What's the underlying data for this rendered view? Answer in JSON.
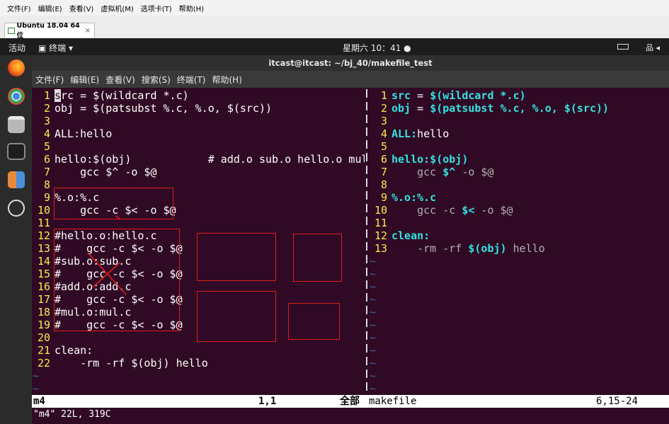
{
  "host_menu": [
    "文件(F)",
    "编辑(E)",
    "查看(V)",
    "虚拟机(M)",
    "选项卡(T)",
    "帮助(H)"
  ],
  "vm_tab": {
    "label": "Ubuntu 18.04 64 位",
    "close": "×"
  },
  "topbar": {
    "activities": "活动",
    "app": "▣ 终端 ▾",
    "clock": "星期六 10：41 ●",
    "net": "品 ◂"
  },
  "window_title": "itcast@itcast: ~/bj_40/makefile_test",
  "term_menu": [
    "文件(F)",
    "编辑(E)",
    "查看(V)",
    "搜索(S)",
    "终端(T)",
    "帮助(H)"
  ],
  "left_lines": [
    {
      "n": "1",
      "t": "src = $(wildcard *.c)"
    },
    {
      "n": "2",
      "t": "obj = $(patsubst %.c, %.o, $(src))"
    },
    {
      "n": "3",
      "t": ""
    },
    {
      "n": "4",
      "t": "ALL:hello"
    },
    {
      "n": "5",
      "t": ""
    },
    {
      "n": "6",
      "t": "hello:$(obj)            # add.o sub.o hello.o mul.o"
    },
    {
      "n": "7",
      "t": "    gcc $^ -o $@"
    },
    {
      "n": "8",
      "t": ""
    },
    {
      "n": "9",
      "t": "%.o:%.c"
    },
    {
      "n": "10",
      "t": "    gcc -c $< -o $@"
    },
    {
      "n": "11",
      "t": ""
    },
    {
      "n": "12",
      "t": "#hello.o:hello.c"
    },
    {
      "n": "13",
      "t": "#    gcc -c $< -o $@"
    },
    {
      "n": "14",
      "t": "#sub.o:sub.c"
    },
    {
      "n": "15",
      "t": "#    gcc -c $< -o $@"
    },
    {
      "n": "16",
      "t": "#add.o:add.c"
    },
    {
      "n": "17",
      "t": "#    gcc -c $< -o $@"
    },
    {
      "n": "18",
      "t": "#mul.o:mul.c"
    },
    {
      "n": "19",
      "t": "#    gcc -c $< -o $@"
    },
    {
      "n": "20",
      "t": ""
    },
    {
      "n": "21",
      "t": "clean:"
    },
    {
      "n": "22",
      "t": "    -rm -rf $(obj) hello"
    }
  ],
  "right_lines": [
    {
      "n": "1",
      "k": "src",
      "r": " = ",
      "v": "$(wildcard *.c)",
      "d": ""
    },
    {
      "n": "2",
      "k": "obj",
      "r": " = ",
      "v": "$(patsubst %.c, %.o, $(src))",
      "d": ""
    },
    {
      "n": "3",
      "k": "",
      "r": "",
      "v": "",
      "d": ""
    },
    {
      "n": "4",
      "k": "ALL:",
      "r": "hello",
      "v": "",
      "d": ""
    },
    {
      "n": "5",
      "k": "",
      "r": "",
      "v": "",
      "d": ""
    },
    {
      "n": "6",
      "k": "hello:$(obj)",
      "r": "",
      "v": "",
      "d": ""
    },
    {
      "n": "7",
      "k": "",
      "r": "    gcc ",
      "v": "$^",
      "d": " -o $@"
    },
    {
      "n": "8",
      "k": "",
      "r": "",
      "v": "",
      "d": ""
    },
    {
      "n": "9",
      "k": "%.o:%.c",
      "r": "",
      "v": "",
      "d": ""
    },
    {
      "n": "10",
      "k": "",
      "r": "    gcc -c ",
      "v": "$<",
      "d": " -o $@"
    },
    {
      "n": "11",
      "k": "",
      "r": "",
      "v": "",
      "d": ""
    },
    {
      "n": "12",
      "k": "clean:",
      "r": "",
      "v": "",
      "d": ""
    },
    {
      "n": "13",
      "k": "",
      "r": "    -rm -rf ",
      "v": "$(obj)",
      "d": " hello"
    }
  ],
  "tilde": "~",
  "status": {
    "left_name": "m4",
    "pos": "1,1",
    "all": "全部",
    "right_name": "makefile",
    "right_pos": "6,15-24"
  },
  "cmdline": "\"m4\" 22L, 319C",
  "colors": {
    "terminal_bg": "#300a24",
    "line_number": "#fce94f",
    "keyword": "#34e2e2",
    "tilde": "#3465a4",
    "annotation": "#e01b1b"
  }
}
